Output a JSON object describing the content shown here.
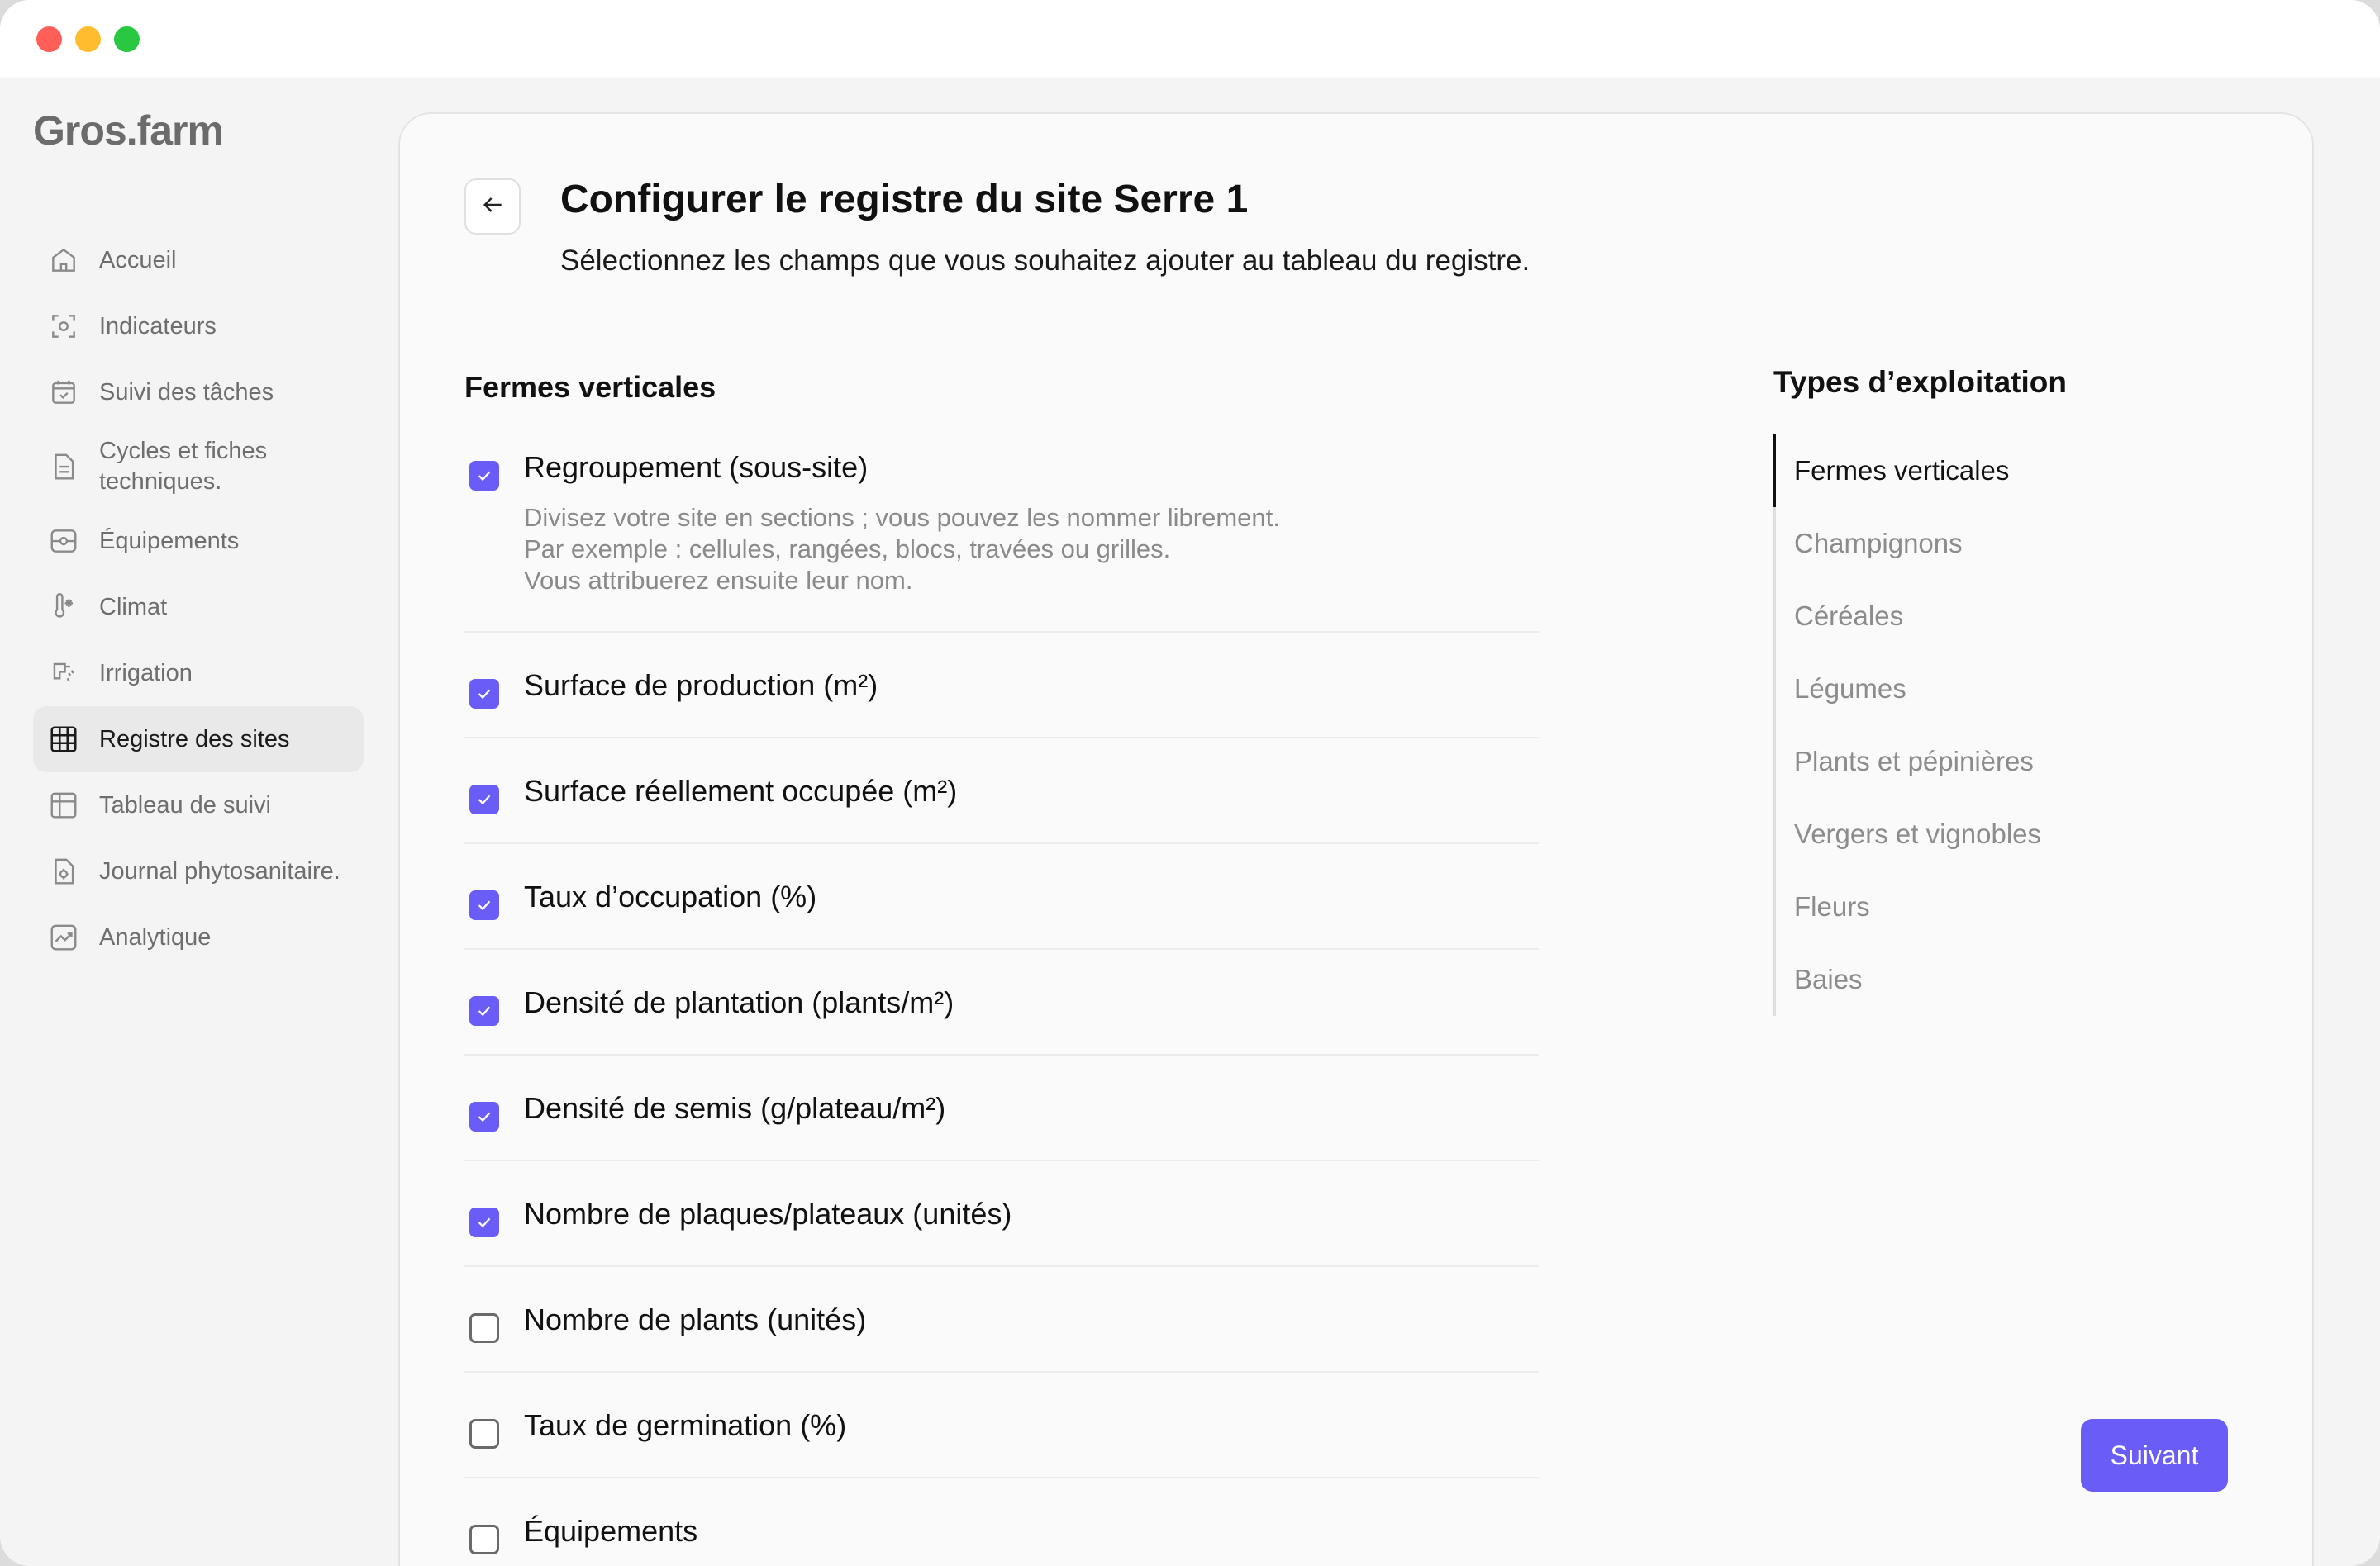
{
  "app": {
    "logo": "Gros.farm"
  },
  "sidebar": {
    "items": [
      {
        "label": "Accueil",
        "icon": "home-icon"
      },
      {
        "label": "Indicateurs",
        "icon": "indicator-icon"
      },
      {
        "label": "Suivi des tâches",
        "icon": "calendar-check-icon"
      },
      {
        "label": "Cycles et fiches techniques.",
        "icon": "document-icon"
      },
      {
        "label": "Équipements",
        "icon": "equipment-icon"
      },
      {
        "label": "Climat",
        "icon": "thermometer-icon"
      },
      {
        "label": "Irrigation",
        "icon": "irrigation-icon"
      },
      {
        "label": "Registre des sites",
        "icon": "grid-icon",
        "active": true
      },
      {
        "label": "Tableau de suivi",
        "icon": "table-icon"
      },
      {
        "label": "Journal phytosanitaire.",
        "icon": "journal-icon"
      },
      {
        "label": "Analytique",
        "icon": "chart-icon"
      }
    ]
  },
  "main": {
    "title": "Configurer le registre du site Serre 1",
    "subtitle": "Sélectionnez les champs que vous souhaitez ajouter au tableau du registre.",
    "section_title": "Fermes verticales",
    "fields": [
      {
        "label": "Regroupement (sous-site)",
        "checked": true,
        "description": "Divisez votre site en sections ; vous pouvez les nommer librement.\nPar exemple : cellules, rangées, blocs, travées ou grilles.\nVous attribuerez ensuite leur nom."
      },
      {
        "label": "Surface de production (m²)",
        "checked": true
      },
      {
        "label": "Surface réellement occupée (m²)",
        "checked": true
      },
      {
        "label": "Taux d’occupation (%)",
        "checked": true
      },
      {
        "label": "Densité de plantation (plants/m²)",
        "checked": true
      },
      {
        "label": "Densité de semis (g/plateau/m²)",
        "checked": true
      },
      {
        "label": "Nombre de plaques/plateaux (unités)",
        "checked": true
      },
      {
        "label": "Nombre de plants (unités)",
        "checked": false
      },
      {
        "label": "Taux de germination (%)",
        "checked": false
      },
      {
        "label": "Équipements",
        "checked": false
      }
    ],
    "types_title": "Types d’exploitation",
    "types": [
      {
        "label": "Fermes verticales",
        "active": true
      },
      {
        "label": "Champignons"
      },
      {
        "label": "Céréales"
      },
      {
        "label": "Légumes"
      },
      {
        "label": "Plants et pépinières"
      },
      {
        "label": "Vergers et vignobles"
      },
      {
        "label": "Fleurs"
      },
      {
        "label": "Baies"
      }
    ],
    "next_label": "Suivant"
  },
  "colors": {
    "accent": "#6a5cf6"
  }
}
